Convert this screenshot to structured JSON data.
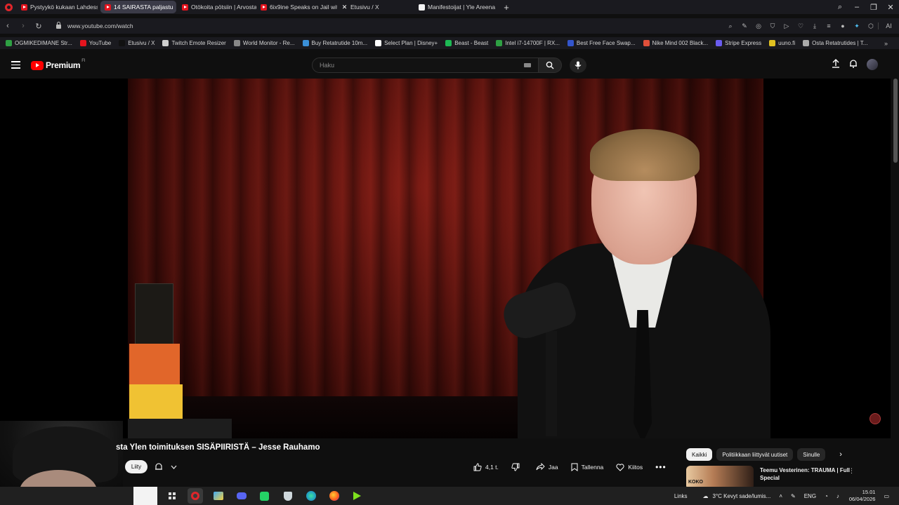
{
  "browser": {
    "tabs": [
      {
        "label": "Pystyykö kukaan Lahdessa",
        "favicon": "youtube",
        "active": false
      },
      {
        "label": "14 SAIRASTA paljastu",
        "favicon": "youtube",
        "active": true
      },
      {
        "label": "Otökoita pötsiin | Arvosta",
        "favicon": "youtube",
        "active": false
      },
      {
        "label": "6ix9ine Speaks on Jail with",
        "favicon": "youtube",
        "active": false
      },
      {
        "label": "Etusivu / X",
        "favicon": "x",
        "active": false
      },
      {
        "label": "Manifestoijat | Yle Areena",
        "favicon": "yle",
        "active": false
      }
    ],
    "new_tab_glyph": "+",
    "url": "www.youtube.com/watch",
    "ai_label": "AI",
    "bookmarks": [
      {
        "label": "OGMIKEDIMANE Str...",
        "color": "#2ea043"
      },
      {
        "label": "YouTube",
        "color": "#e4141e"
      },
      {
        "label": "Etusivu / X",
        "color": "#111111"
      },
      {
        "label": "Twitch Emote Resizer",
        "color": "#cfcfcf"
      },
      {
        "label": "World Monitor - Re...",
        "color": "#888888"
      },
      {
        "label": "Buy Retatrutide 10m...",
        "color": "#3a8fd8"
      },
      {
        "label": "Select Plan | Disney+",
        "color": "#ffffff"
      },
      {
        "label": "Beast - Beast",
        "color": "#1db954"
      },
      {
        "label": "Intel i7-14700F | RX...",
        "color": "#2ea043"
      },
      {
        "label": "Best Free Face Swap...",
        "color": "#3355cc"
      },
      {
        "label": "Nike Mind 002 Black...",
        "color": "#e0503a"
      },
      {
        "label": "Stripe Express",
        "color": "#6a5cf0"
      },
      {
        "label": "uuno.fi",
        "color": "#e0c020"
      },
      {
        "label": "Osta Retatrutides | T...",
        "color": "#aaaaaa"
      }
    ]
  },
  "youtube": {
    "logo_text": "Premium",
    "logo_superscript": "FI",
    "search_placeholder": "Haku",
    "video_title": "sta Ylen toimituksen SISÄPIIRISTÄ – Jesse Rauhamo",
    "subscribe_label": "Liity",
    "actions": {
      "like_count": "4,1 t.",
      "share": "Jaa",
      "save": "Tallenna",
      "thanks": "Kiitos"
    },
    "chips": [
      "Kaikki",
      "Politiikkaan liittyvät uutiset",
      "Sinulle"
    ],
    "recommendation": {
      "title": "Teemu Vesterinen: TRAUMA | Full Special",
      "thumb_text": "KOKO"
    }
  },
  "taskbar": {
    "links_label": "Links",
    "weather": "3°C  Kevyt sade/lumis...",
    "language": "ENG",
    "time": "15.01",
    "date": "06/04/2026"
  }
}
